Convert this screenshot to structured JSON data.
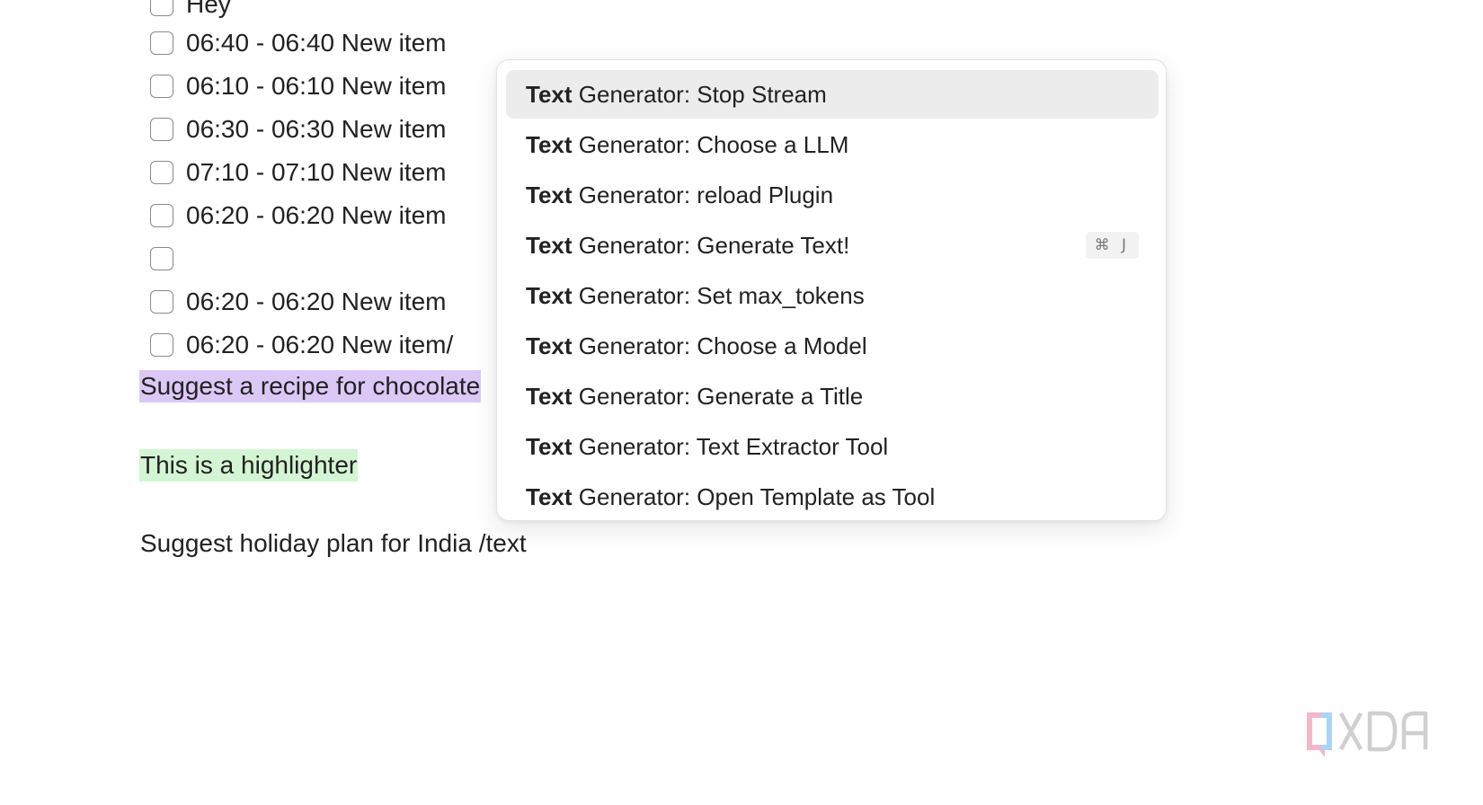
{
  "tasks": [
    {
      "text": "Hey"
    },
    {
      "text": "06:40 - 06:40 New item"
    },
    {
      "text": "06:10 - 06:10 New item"
    },
    {
      "text": "06:30 - 06:30 New item"
    },
    {
      "text": "07:10 - 07:10 New item"
    },
    {
      "text": "06:20 - 06:20 New item"
    },
    {
      "text": ""
    },
    {
      "text": "06:20 - 06:20 New item"
    },
    {
      "text": "06:20 - 06:20 New item/"
    }
  ],
  "paragraphs": {
    "recipe": "Suggest a recipe for chocolate",
    "highlighter": "This is a highlighter",
    "holiday": "Suggest holiday plan for India /text"
  },
  "command_menu": {
    "items": [
      {
        "bold": "Text",
        "rest": " Generator: Stop Stream",
        "selected": true
      },
      {
        "bold": "Text",
        "rest": " Generator: Choose a LLM"
      },
      {
        "bold": "Text",
        "rest": " Generator: reload Plugin"
      },
      {
        "bold": "Text",
        "rest": " Generator: Generate Text!",
        "hotkey": "⌘ J"
      },
      {
        "bold": "Text",
        "rest": " Generator: Set max_tokens"
      },
      {
        "bold": "Text",
        "rest": " Generator: Choose a Model"
      },
      {
        "bold": "Text",
        "rest": " Generator: Generate a Title"
      },
      {
        "bold": "Text",
        "rest": " Generator: Text Extractor Tool"
      },
      {
        "bold": "Text",
        "rest": " Generator: Open Template as Tool"
      }
    ]
  },
  "watermark": {
    "brand": "XDA"
  },
  "colors": {
    "highlight_purple": "#dcc8f7",
    "highlight_green": "#d3f5d3",
    "selected_row": "#ececec"
  }
}
